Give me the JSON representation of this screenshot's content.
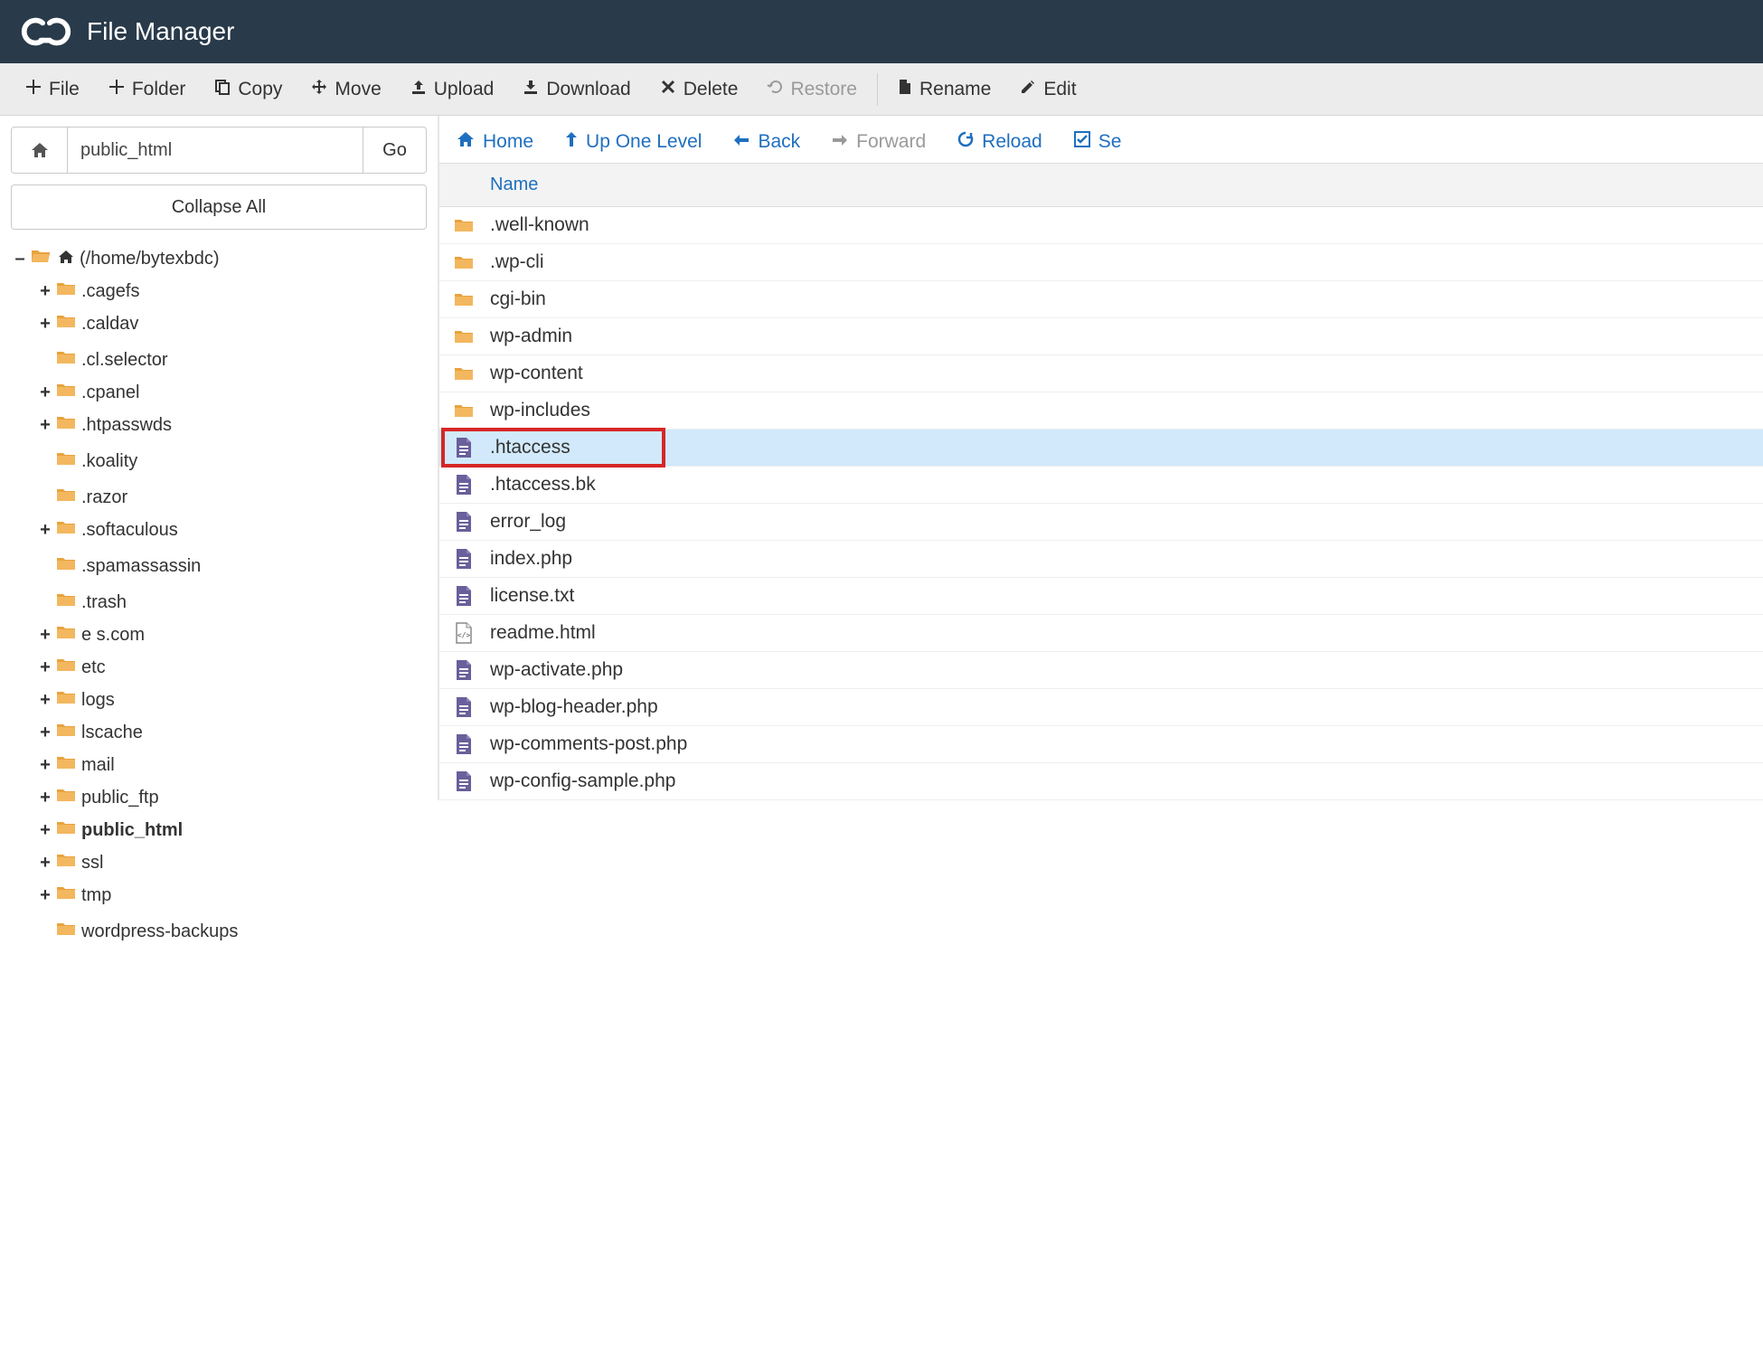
{
  "header": {
    "title": "File Manager"
  },
  "toolbar": {
    "file": "File",
    "folder": "Folder",
    "copy": "Copy",
    "move": "Move",
    "upload": "Upload",
    "download": "Download",
    "delete": "Delete",
    "restore": "Restore",
    "rename": "Rename",
    "edit": "Edit"
  },
  "pathbar": {
    "value": "public_html",
    "go": "Go"
  },
  "collapse_all": "Collapse All",
  "tree": {
    "root": {
      "toggle": "–",
      "label": "(/home/bytexbdc)"
    },
    "items": [
      {
        "toggle": "+",
        "label": ".cagefs"
      },
      {
        "toggle": "+",
        "label": ".caldav"
      },
      {
        "toggle": "",
        "label": ".cl.selector"
      },
      {
        "toggle": "+",
        "label": ".cpanel"
      },
      {
        "toggle": "+",
        "label": ".htpasswds"
      },
      {
        "toggle": "",
        "label": ".koality"
      },
      {
        "toggle": "",
        "label": ".razor"
      },
      {
        "toggle": "+",
        "label": ".softaculous"
      },
      {
        "toggle": "",
        "label": ".spamassassin"
      },
      {
        "toggle": "",
        "label": ".trash"
      },
      {
        "toggle": "+",
        "label": "e                    s.com"
      },
      {
        "toggle": "+",
        "label": "etc"
      },
      {
        "toggle": "+",
        "label": "logs"
      },
      {
        "toggle": "+",
        "label": "lscache"
      },
      {
        "toggle": "+",
        "label": "mail"
      },
      {
        "toggle": "+",
        "label": "public_ftp"
      },
      {
        "toggle": "+",
        "label": "public_html",
        "bold": true
      },
      {
        "toggle": "+",
        "label": "ssl"
      },
      {
        "toggle": "+",
        "label": "tmp"
      },
      {
        "toggle": "",
        "label": "wordpress-backups"
      }
    ]
  },
  "nav": {
    "home": "Home",
    "up": "Up One Level",
    "back": "Back",
    "forward": "Forward",
    "reload": "Reload",
    "select": "Se"
  },
  "table": {
    "col_name": "Name"
  },
  "files": [
    {
      "type": "folder",
      "label": ".well-known"
    },
    {
      "type": "folder",
      "label": ".wp-cli"
    },
    {
      "type": "folder",
      "label": "cgi-bin"
    },
    {
      "type": "folder",
      "label": "wp-admin"
    },
    {
      "type": "folder",
      "label": "wp-content"
    },
    {
      "type": "folder",
      "label": "wp-includes"
    },
    {
      "type": "file",
      "label": ".htaccess",
      "selected": true,
      "highlighted": true
    },
    {
      "type": "file",
      "label": ".htaccess.bk"
    },
    {
      "type": "file",
      "label": "error_log"
    },
    {
      "type": "file",
      "label": "index.php"
    },
    {
      "type": "file",
      "label": "license.txt"
    },
    {
      "type": "html",
      "label": "readme.html"
    },
    {
      "type": "file",
      "label": "wp-activate.php"
    },
    {
      "type": "file",
      "label": "wp-blog-header.php"
    },
    {
      "type": "file",
      "label": "wp-comments-post.php"
    },
    {
      "type": "file",
      "label": "wp-config-sample.php"
    }
  ]
}
